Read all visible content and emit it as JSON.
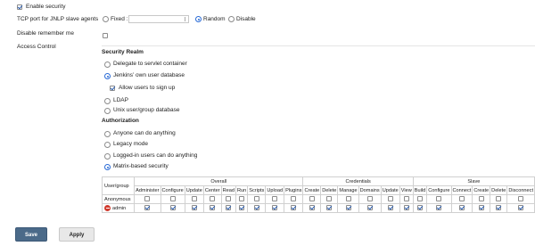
{
  "enable_security": {
    "label": "Enable security",
    "checked": true
  },
  "jnlp": {
    "label": "TCP port for JNLP slave agents",
    "options": [
      {
        "label": "Fixed :",
        "selected": false
      },
      {
        "label": "Random",
        "selected": true
      },
      {
        "label": "Disable",
        "selected": false
      }
    ]
  },
  "disable_remember": {
    "label": "Disable remember me",
    "checked": false
  },
  "access_control": {
    "label": "Access Control"
  },
  "security_realm": {
    "heading": "Security Realm",
    "options": [
      {
        "label": "Delegate to servlet container",
        "selected": false
      },
      {
        "label": "Jenkins’ own user database",
        "selected": true
      },
      {
        "label": "LDAP",
        "selected": false
      },
      {
        "label": "Unix user/group database",
        "selected": false
      }
    ],
    "allow_signup": {
      "label": "Allow users to sign up",
      "checked": true
    }
  },
  "authorization": {
    "heading": "Authorization",
    "options": [
      {
        "label": "Anyone can do anything",
        "selected": false
      },
      {
        "label": "Legacy mode",
        "selected": false
      },
      {
        "label": "Logged-in users can do anything",
        "selected": false
      },
      {
        "label": "Matrix-based security",
        "selected": true
      }
    ]
  },
  "matrix": {
    "user_group_header": "User/group",
    "groups": [
      "Overall",
      "Credentials",
      "Slave"
    ],
    "columns": [
      "Administer",
      "Configure",
      "Update",
      "Center",
      "Read",
      "Run",
      "Scripts",
      "Upload",
      "Plugins",
      "Create",
      "Delete",
      "Manage",
      "Domains",
      "Update",
      "View",
      "Build",
      "Configure",
      "Connect",
      "Create",
      "Delete",
      "Disconnect"
    ],
    "rows": [
      {
        "name": "Anonymous",
        "perms": [
          false,
          false,
          false,
          false,
          false,
          false,
          false,
          false,
          false,
          false,
          false,
          false,
          false,
          false,
          false,
          false,
          false,
          false,
          false,
          false,
          false
        ]
      },
      {
        "name": "admin",
        "perms": [
          true,
          true,
          true,
          true,
          true,
          true,
          true,
          true,
          true,
          true,
          true,
          true,
          true,
          true,
          true,
          true,
          true,
          true,
          true,
          true,
          true
        ]
      }
    ]
  },
  "buttons": {
    "save": "Save",
    "apply": "Apply"
  }
}
